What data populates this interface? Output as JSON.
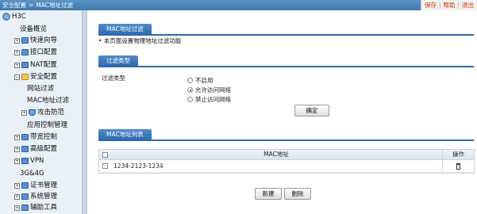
{
  "topbar": {
    "breadcrumb": [
      "安全配置",
      "MAC地址过滤"
    ],
    "separator": ">",
    "links": [
      "保存",
      "帮助",
      "退出"
    ],
    "link_separator": "|"
  },
  "sidebar": {
    "root": "H3C",
    "items": [
      {
        "label": "设备概览",
        "icon": "none"
      },
      {
        "label": "快速向导",
        "icon": "folder-icon"
      },
      {
        "label": "接口配置",
        "icon": "folder-icon"
      },
      {
        "label": "NAT配置",
        "icon": "folder-icon"
      },
      {
        "label": "安全配置",
        "icon": "folder-open-icon"
      },
      {
        "label": "网站过滤",
        "icon": "none"
      },
      {
        "label": "MAC地址过滤",
        "icon": "none"
      },
      {
        "label": "攻击防范",
        "icon": "folder-icon"
      },
      {
        "label": "应用控制管理",
        "icon": "none"
      },
      {
        "label": "带宽控制",
        "icon": "folder-icon"
      },
      {
        "label": "高级配置",
        "icon": "folder-icon"
      },
      {
        "label": "VPN",
        "icon": "folder-icon"
      },
      {
        "label": "3G&4G",
        "icon": "none"
      },
      {
        "label": "证书管理",
        "icon": "folder-icon"
      },
      {
        "label": "系统管理",
        "icon": "folder-icon"
      },
      {
        "label": "辅助工具",
        "icon": "folder-icon"
      }
    ]
  },
  "main": {
    "section1": {
      "title": "MAC地址过滤",
      "note": "• 本页面设置物理地址过滤功能"
    },
    "section2": {
      "title": "过滤类型",
      "field_label": "过滤类型",
      "options": [
        "不启用",
        "允许访问网络",
        "禁止访问网络"
      ],
      "selected_index": 1,
      "confirm_label": "确定"
    },
    "section3": {
      "title": "MAC地址列表",
      "columns": {
        "mac": "MAC地址",
        "op": "操作"
      },
      "rows": [
        {
          "mac": "1234-2123-1234"
        }
      ],
      "new_label": "新建",
      "delete_label": "删除"
    }
  },
  "colors": {
    "accent": "#2f69ab",
    "topbar": "#4a85bb",
    "sidebar_bg": "#e9f0f7",
    "link": "#cc3300"
  }
}
